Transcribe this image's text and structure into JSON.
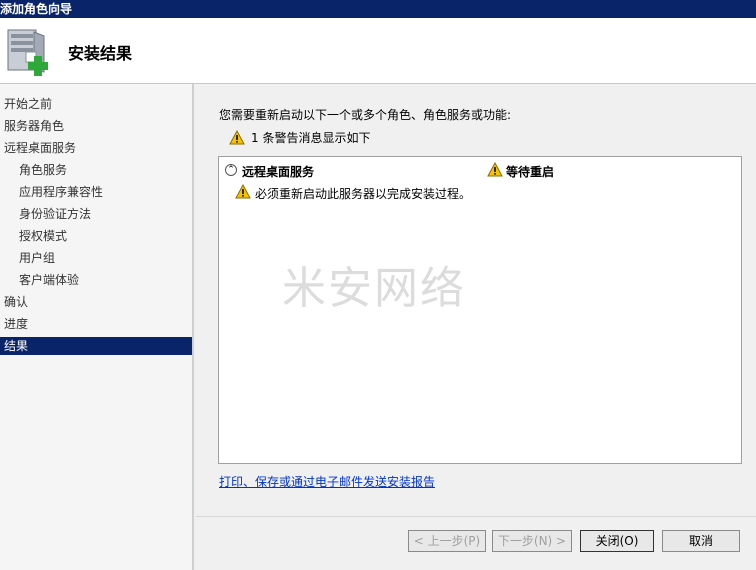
{
  "window": {
    "title": "添加角色向导"
  },
  "header": {
    "title": "安装结果",
    "icon": "server-add-icon"
  },
  "sidebar": {
    "items": [
      {
        "label": "开始之前"
      },
      {
        "label": "服务器角色"
      },
      {
        "label": "远程桌面服务"
      },
      {
        "label": "角色服务"
      },
      {
        "label": "应用程序兼容性"
      },
      {
        "label": "身份验证方法"
      },
      {
        "label": "授权模式"
      },
      {
        "label": "用户组"
      },
      {
        "label": "客户端体验"
      },
      {
        "label": "确认"
      },
      {
        "label": "进度"
      },
      {
        "label": "结果"
      }
    ]
  },
  "main": {
    "intro": "您需要重新启动以下一个或多个角色、角色服务或功能:",
    "warning_summary": "1 条警告消息显示如下",
    "results": [
      {
        "role": "远程桌面服务",
        "status": "等待重启",
        "detail": "必须重新启动此服务器以完成安装过程。"
      }
    ],
    "report_link": "打印、保存或通过电子邮件发送安装报告"
  },
  "buttons": {
    "prev": "< 上一步(P)",
    "next": "下一步(N) >",
    "close": "关闭(O)",
    "cancel": "取消"
  },
  "watermark": "米安网络",
  "colors": {
    "accent": "#0a246a",
    "link": "#0033cc",
    "warning": "#f5c400"
  }
}
